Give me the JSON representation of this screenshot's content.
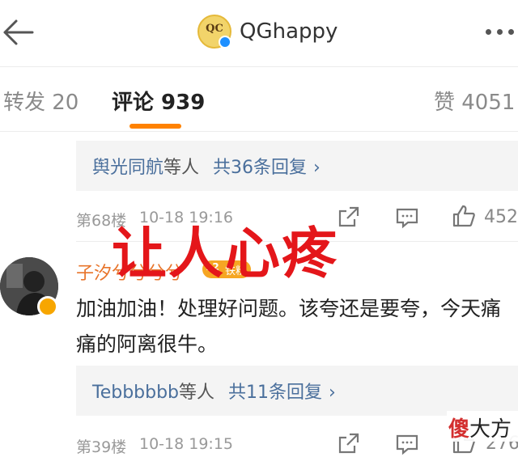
{
  "header": {
    "title": "QGhappy",
    "logo_text": "QC"
  },
  "tabs": [
    {
      "label": "转发 20"
    },
    {
      "label": "评论 939"
    },
    {
      "label": "赞 4051"
    }
  ],
  "reply1": {
    "names": "舆光同航",
    "suffix": "等人",
    "count": "共36条回复"
  },
  "meta1": {
    "floor": "第68楼",
    "time": "10-18 19:16",
    "likes": "452"
  },
  "comment2": {
    "username": "子汐兮兮兮兮",
    "badge_level": "12",
    "badge_text": "铁粉",
    "text": "加油加油！处理好问题。该夸还是要夸，今天痛痛的阿离很牛。"
  },
  "reply2": {
    "names": "Tebbbbbb",
    "suffix": "等人",
    "count": "共11条回复"
  },
  "meta2": {
    "floor": "第39楼",
    "time": "10-18 19:15",
    "likes": "276"
  },
  "overlay": {
    "stamp": "让人心疼",
    "watermark_a": "傻",
    "watermark_b": "大方"
  },
  "colors": {
    "accent": "#ff8200",
    "link": "#4a6f9c",
    "username": "#e8742a",
    "stamp": "#e4161a"
  }
}
